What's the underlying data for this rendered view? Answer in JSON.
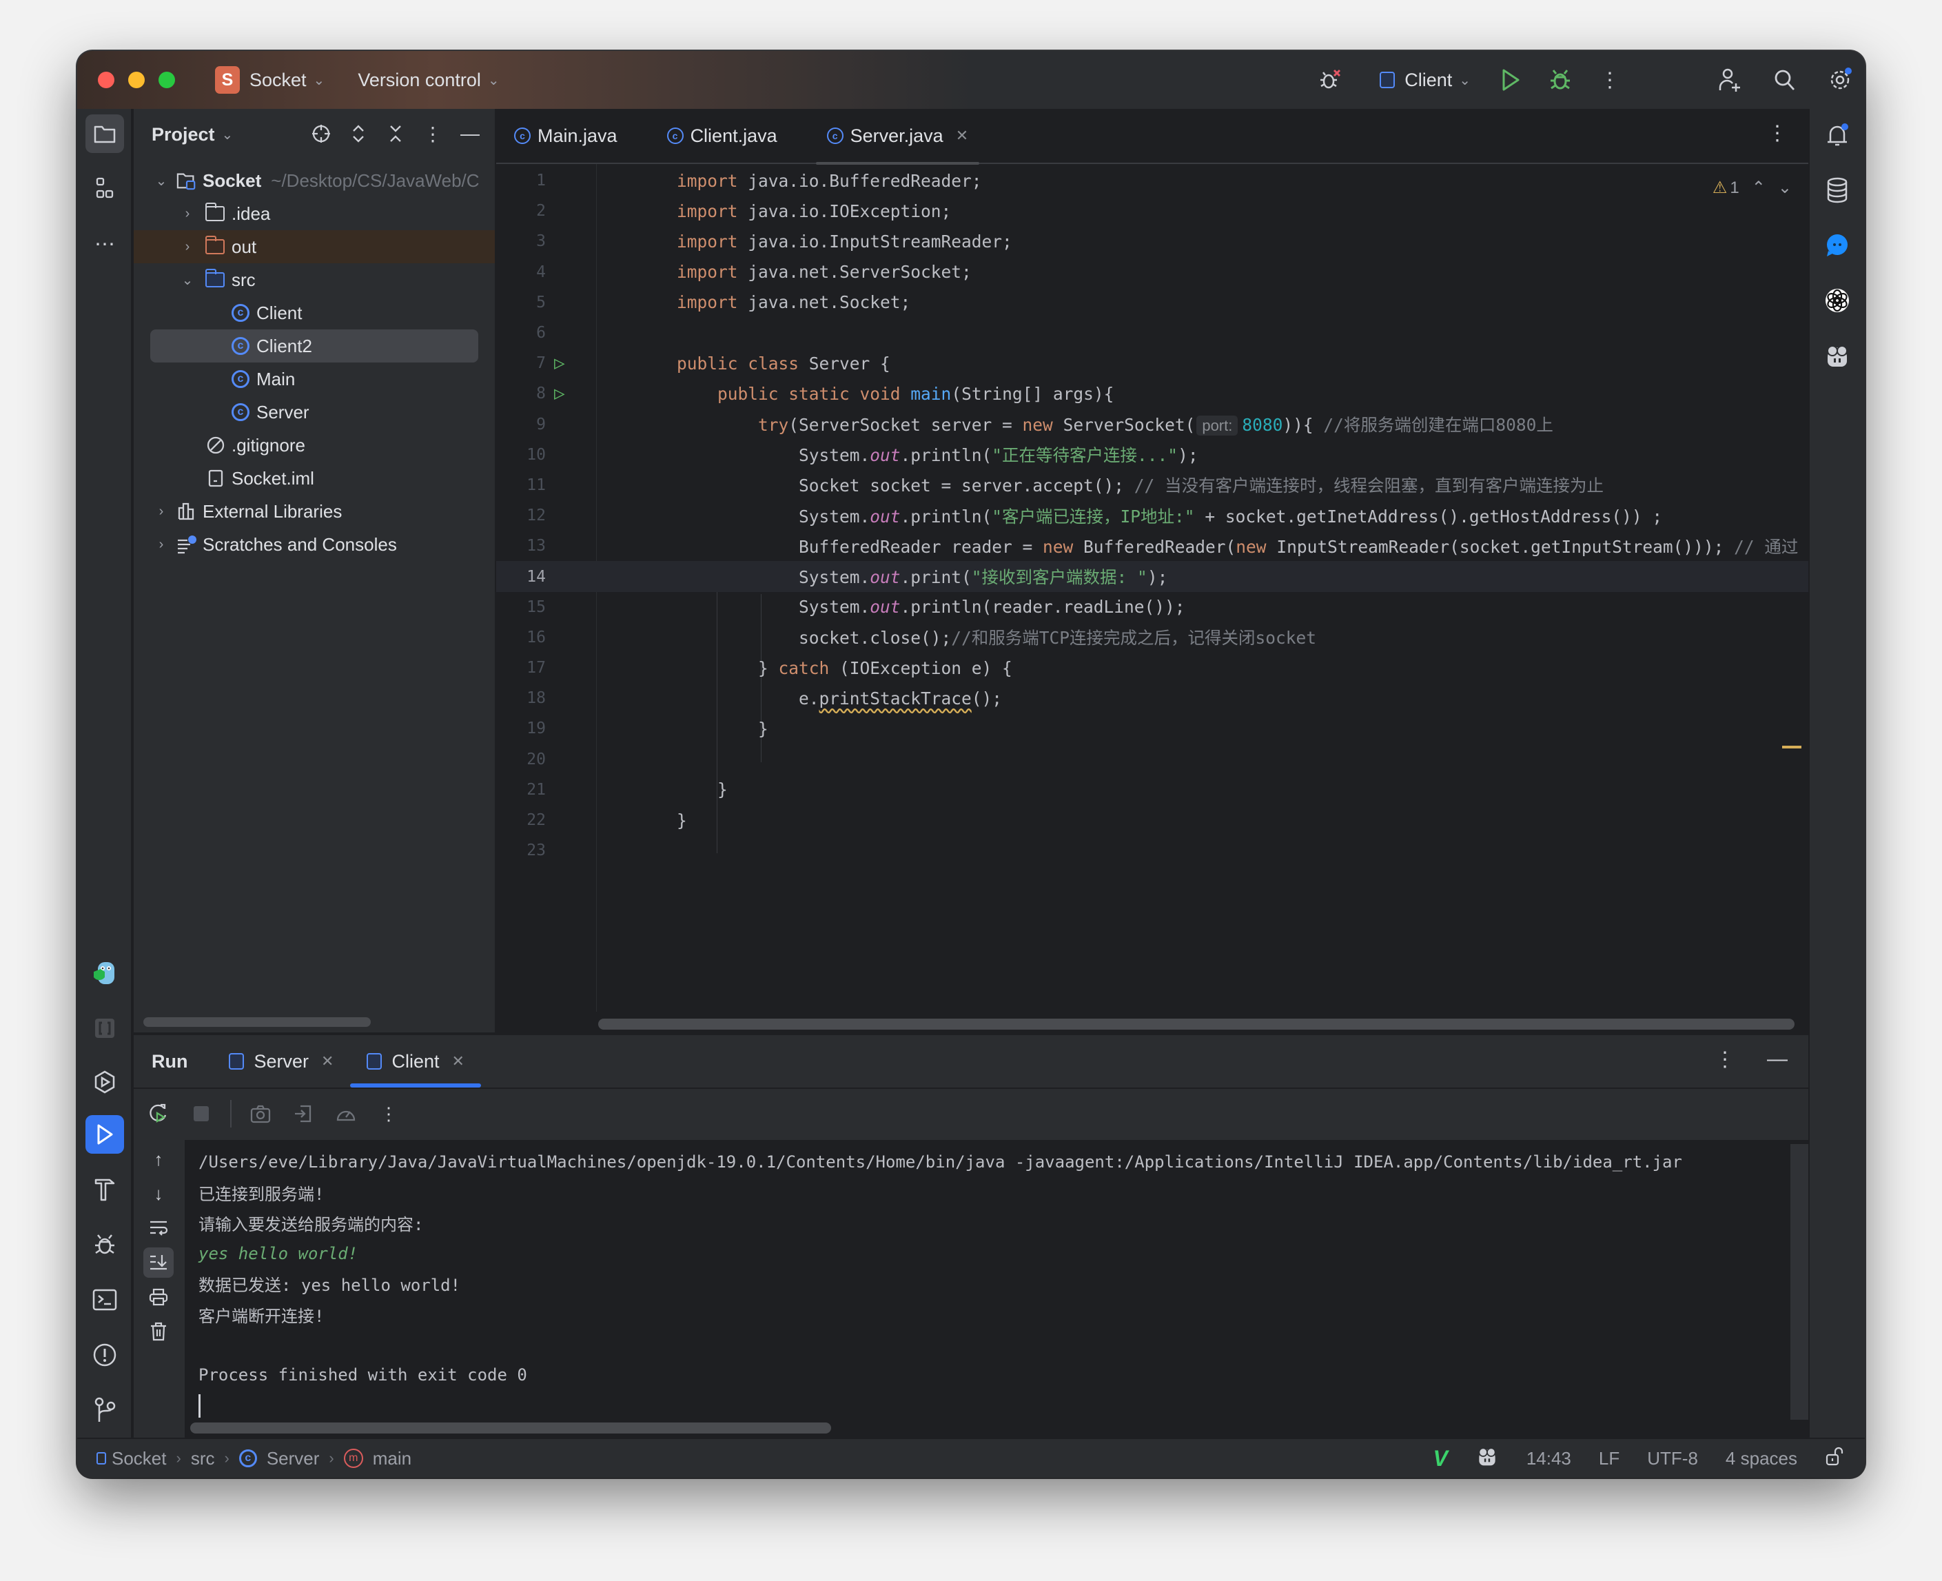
{
  "titlebar": {
    "project_initial": "S",
    "project_name": "Socket",
    "vcs_label": "Version control",
    "run_config": "Client",
    "icons": [
      "debug-disabled-icon",
      "run-icon",
      "debug-icon",
      "more-icon",
      "add-user-icon",
      "search-icon",
      "settings-icon"
    ]
  },
  "left_strip": {
    "icons": [
      "project-folder-icon",
      "structure-icon",
      "more-tools-icon",
      "gopher-plugin-icon",
      "brackets-icon",
      "services-icon",
      "run-icon",
      "build-icon",
      "debug-icon",
      "terminal-icon",
      "problems-icon",
      "git-icon"
    ]
  },
  "project_panel": {
    "title": "Project",
    "tree": [
      {
        "label": "Socket",
        "hint": "~/Desktop/CS/JavaWeb/C",
        "type": "module",
        "expanded": true
      },
      {
        "label": ".idea",
        "type": "folder",
        "expanded": false
      },
      {
        "label": "out",
        "type": "folder-excluded",
        "expanded": false
      },
      {
        "label": "src",
        "type": "folder-source",
        "expanded": true
      },
      {
        "label": "Client",
        "type": "class"
      },
      {
        "label": "Client2",
        "type": "class",
        "selected": true
      },
      {
        "label": "Main",
        "type": "class"
      },
      {
        "label": "Server",
        "type": "class"
      },
      {
        "label": ".gitignore",
        "type": "ignore-file"
      },
      {
        "label": "Socket.iml",
        "type": "iml-file"
      },
      {
        "label": "External Libraries",
        "type": "library",
        "expanded": false
      },
      {
        "label": "Scratches and Consoles",
        "type": "scratches",
        "expanded": false
      }
    ]
  },
  "editor": {
    "tabs": [
      {
        "label": "Main.java",
        "active": false
      },
      {
        "label": "Client.java",
        "active": false
      },
      {
        "label": "Server.java",
        "active": true
      }
    ],
    "warnings_count": "1",
    "current_line": 14,
    "lines": [
      "import java.io.BufferedReader;",
      "import java.io.IOException;",
      "import java.io.InputStreamReader;",
      "import java.net.ServerSocket;",
      "import java.net.Socket;",
      "",
      "public class Server {",
      "    public static void main(String[] args){",
      "        try(ServerSocket server = new ServerSocket( port: 8080)){ //将服务端创建在端口8080上",
      "            System.out.println(\"正在等待客户连接...\");",
      "            Socket socket = server.accept(); // 当没有客户端连接时，线程会阻塞，直到有客户端连接为止",
      "            System.out.println(\"客户端已连接，IP地址:\" + socket.getInetAddress().getHostAddress()) ;",
      "            BufferedReader reader = new BufferedReader(new InputStreamReader(socket.getInputStream())); // 通过",
      "            System.out.print(\"接收到客户端数据: \");",
      "            System.out.println(reader.readLine());",
      "            socket.close();//和服务端TCP连接完成之后，记得关闭socket",
      "        } catch (IOException e) {",
      "            e.printStackTrace();",
      "        }",
      "",
      "    }",
      "}",
      ""
    ]
  },
  "right_strip": {
    "icons": [
      "notifications-icon",
      "database-icon",
      "chat-icon",
      "openai-icon",
      "copilot-icon"
    ]
  },
  "run_panel": {
    "title": "Run",
    "tabs": [
      {
        "label": "Server",
        "active": false
      },
      {
        "label": "Client",
        "active": true
      }
    ],
    "console": [
      {
        "text": "/Users/eve/Library/Java/JavaVirtualMachines/openjdk-19.0.1/Contents/Home/bin/java -javaagent:/Applications/IntelliJ IDEA.app/Contents/lib/idea_rt.jar",
        "kind": "output"
      },
      {
        "text": "已连接到服务端!",
        "kind": "output"
      },
      {
        "text": "请输入要发送给服务端的内容:",
        "kind": "output"
      },
      {
        "text": "yes hello world!",
        "kind": "input"
      },
      {
        "text": "数据已发送: yes hello world!",
        "kind": "output"
      },
      {
        "text": "客户端断开连接!",
        "kind": "output"
      },
      {
        "text": "",
        "kind": "output"
      },
      {
        "text": "Process finished with exit code 0",
        "kind": "output"
      }
    ]
  },
  "statusbar": {
    "breadcrumb": [
      "Socket",
      "src",
      "Server",
      "main"
    ],
    "position": "14:43",
    "line_separator": "LF",
    "encoding": "UTF-8",
    "indent": "4 spaces"
  }
}
